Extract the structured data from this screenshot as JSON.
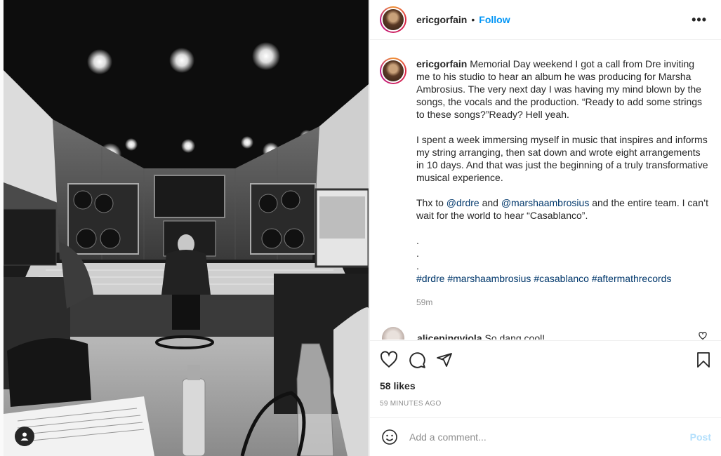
{
  "post": {
    "username": "ericgorfain",
    "separator": "•",
    "follow_label": "Follow",
    "more_label": "•••",
    "caption": {
      "username": "ericgorfain",
      "p1": " Memorial Day weekend I got a call from Dre inviting me to his studio to hear an album he was producing for Marsha Ambrosius. The very next day I was having my mind blown by the songs, the vocals and the production. “Ready to add some strings to these songs?”Ready? Hell yeah.",
      "p2": "I spent a week immersing myself in music that inspires and informs my string arranging, then sat down and wrote eight arrangements in 10 days. And that was just the beginning of a truly transformative musical experience.",
      "p3_prefix": "Thx to ",
      "mention1": "@drdre",
      "p3_and": " and ",
      "mention2": "@marshaambrosius",
      "p3_suffix": " and the entire team. I can’t wait for the world to hear “Casablanco”.",
      "dots": ".\n.\n.",
      "hashtags": [
        "#drdre",
        "#marshaambrosius",
        "#casablanco",
        "#aftermathrecords"
      ],
      "time": "59m"
    },
    "comment": {
      "username": "alicepingviola",
      "text": " So dang cool!"
    },
    "likes": "58 likes",
    "time_ago": "59 MINUTES AGO",
    "add_comment_placeholder": "Add a comment...",
    "post_label": "Post"
  },
  "icons": {
    "like": "heart-icon",
    "comment": "comment-icon",
    "share": "paper-plane-icon",
    "save": "bookmark-icon",
    "emoji": "smiley-icon",
    "user_tag": "person-icon"
  },
  "colors": {
    "follow": "#0095f6",
    "mention": "#00376b",
    "post_disabled": "#b2dffc",
    "muted": "#8e8e8e"
  }
}
